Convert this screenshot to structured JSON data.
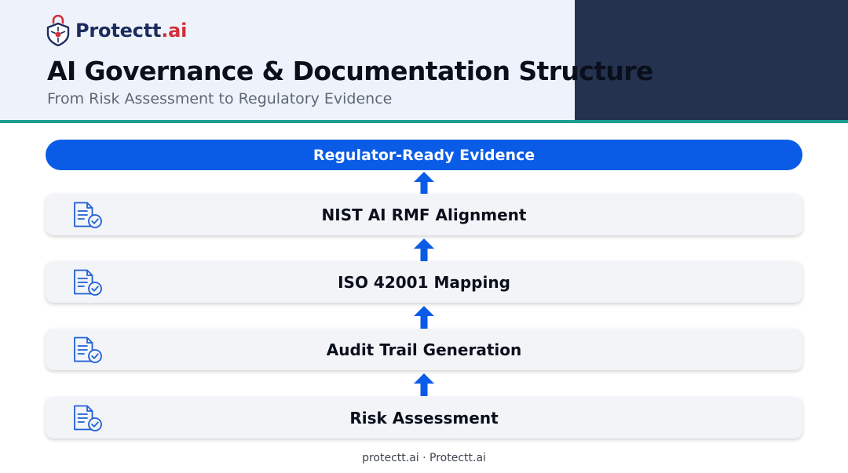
{
  "brand": {
    "name_main": "Protectt",
    "name_accent": ".ai"
  },
  "header": {
    "title": "AI Governance & Documentation Structure",
    "subtitle": "From Risk Assessment to Regulatory Evidence"
  },
  "diagram": {
    "top_label": "Regulator-Ready Evidence",
    "layers": [
      {
        "label": "NIST AI RMF Alignment",
        "icon": "document-check-icon"
      },
      {
        "label": "ISO 42001 Mapping",
        "icon": "document-check-icon"
      },
      {
        "label": "Audit Trail Generation",
        "icon": "document-check-icon"
      },
      {
        "label": "Risk Assessment",
        "icon": "document-check-icon"
      }
    ],
    "arrow_icon": "arrow-up-icon"
  },
  "footer": {
    "text": "protectt.ai · Protectt.ai"
  },
  "colors": {
    "primary_blue": "#0a5ce6",
    "navy": "#24324f",
    "teal": "#1a9f8e",
    "brand_red": "#d32f3a",
    "header_bg": "#eef3fb"
  }
}
